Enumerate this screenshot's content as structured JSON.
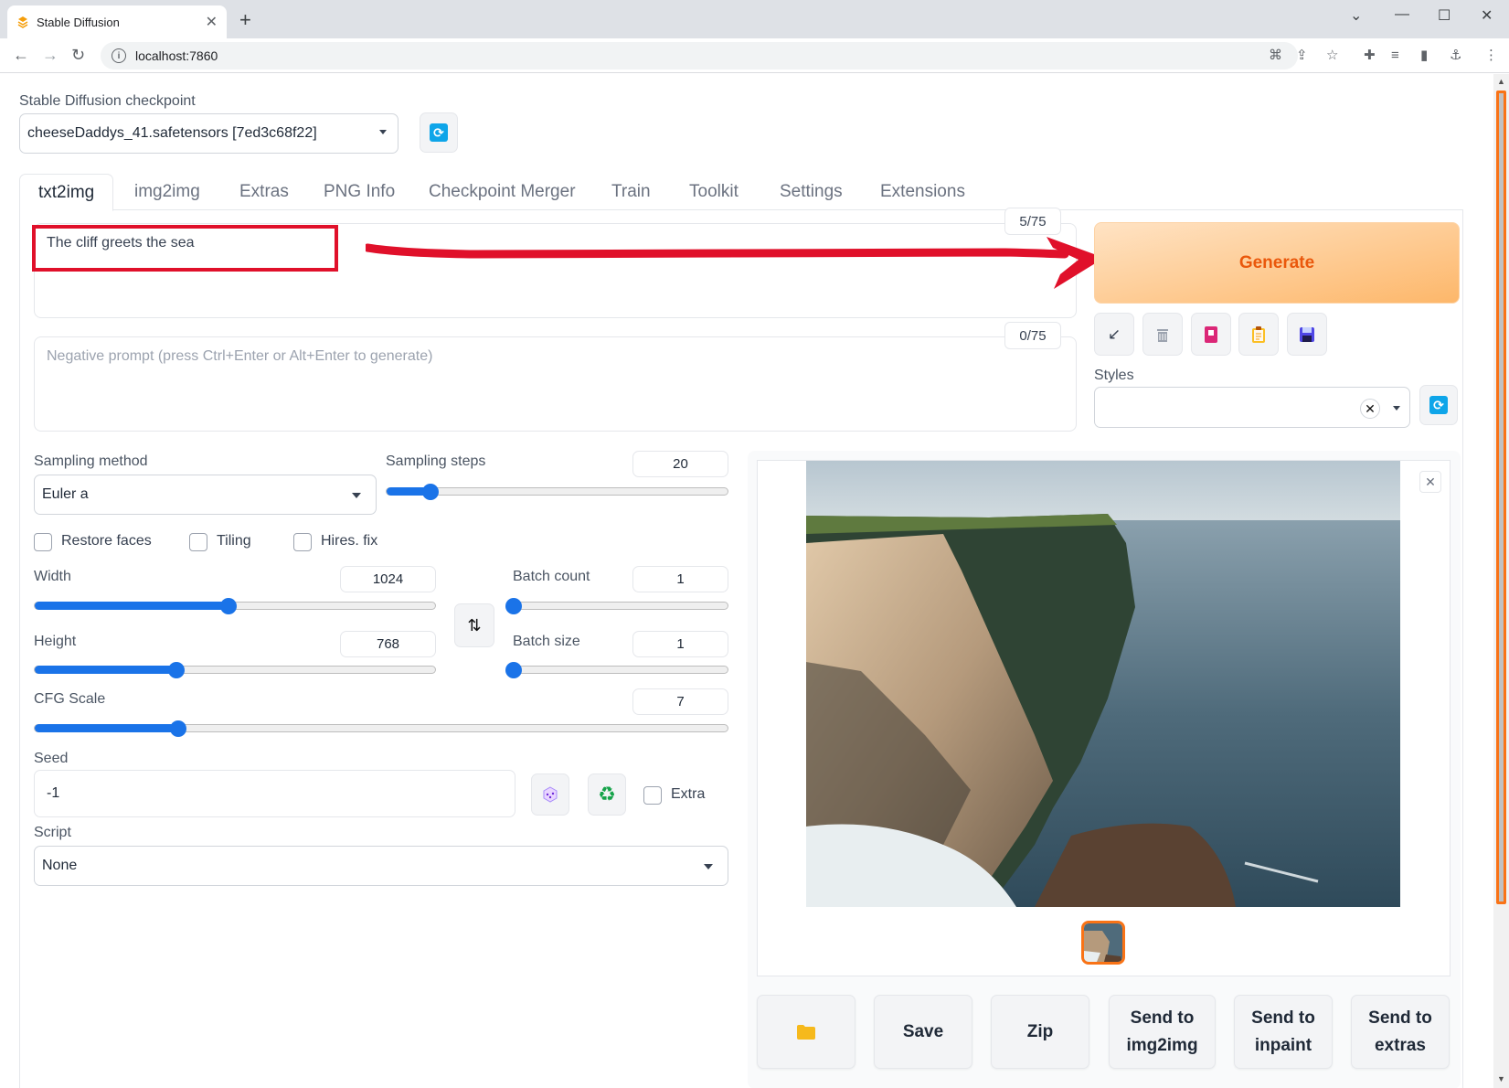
{
  "browser": {
    "tab_title": "Stable Diffusion",
    "new_tab": "+",
    "url": "localhost:7860"
  },
  "checkpoint": {
    "label": "Stable Diffusion checkpoint",
    "value": "cheeseDaddys_41.safetensors [7ed3c68f22]"
  },
  "tabs": [
    "txt2img",
    "img2img",
    "Extras",
    "PNG Info",
    "Checkpoint Merger",
    "Train",
    "Toolkit",
    "Settings",
    "Extensions"
  ],
  "active_tab": "txt2img",
  "prompt": {
    "value": "The cliff greets the sea",
    "token_count": "5/75"
  },
  "negative_prompt": {
    "placeholder": "Negative prompt (press Ctrl+Enter or Alt+Enter to generate)",
    "token_count": "0/75"
  },
  "generate_label": "Generate",
  "tool_icons": [
    "arrow-icon",
    "trash-icon",
    "card-icon",
    "clipboard-icon",
    "save-icon"
  ],
  "styles": {
    "label": "Styles",
    "value": ""
  },
  "sampling": {
    "method_label": "Sampling method",
    "method_value": "Euler a",
    "steps_label": "Sampling steps",
    "steps_value": "20",
    "steps_min": 1,
    "steps_max": 150
  },
  "checkboxes": {
    "restore_faces": "Restore faces",
    "tiling": "Tiling",
    "hires_fix": "Hires. fix"
  },
  "width": {
    "label": "Width",
    "value": "1024",
    "min": 64,
    "max": 2048
  },
  "height": {
    "label": "Height",
    "value": "768",
    "min": 64,
    "max": 2048
  },
  "batch_count": {
    "label": "Batch count",
    "value": "1",
    "min": 1,
    "max": 100
  },
  "batch_size": {
    "label": "Batch size",
    "value": "1",
    "min": 1,
    "max": 8
  },
  "cfg": {
    "label": "CFG Scale",
    "value": "7",
    "min": 1,
    "max": 30
  },
  "seed": {
    "label": "Seed",
    "value": "-1",
    "extra_label": "Extra"
  },
  "script": {
    "label": "Script",
    "value": "None"
  },
  "actions": {
    "open_folder": "",
    "save": "Save",
    "zip": "Zip",
    "send_img2img_1": "Send to",
    "send_img2img_2": "img2img",
    "send_inpaint_1": "Send to",
    "send_inpaint_2": "inpaint",
    "send_extras_1": "Send to",
    "send_extras_2": "extras"
  },
  "colors": {
    "accent": "#1a73e8",
    "generate_text": "#ea580c",
    "highlight": "#e0102a"
  }
}
